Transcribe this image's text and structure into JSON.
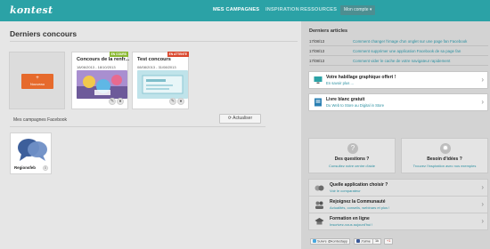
{
  "app": {
    "logo": "kontest"
  },
  "nav": {
    "items": [
      {
        "label": "MES CAMPAGNES"
      },
      {
        "label": "INSPIRATION"
      },
      {
        "label": "RESSOURCES"
      }
    ],
    "account_label": "Mon compte ▾"
  },
  "main": {
    "title": "Derniers concours",
    "new_button": {
      "plus": "+",
      "label": "Nouveau"
    },
    "campaigns": [
      {
        "title": "Concours de la renfr...",
        "dates": "18/06/2013 - 18/10/2013",
        "badge": "EN COURS",
        "thumb_color": "#8e6fb6"
      },
      {
        "title": "Test concours",
        "dates": "08/08/2013 - 31/08/2013",
        "badge": "EN ATTENTE",
        "thumb_color": "#9fd0dc"
      }
    ],
    "facebook_label": "Mes campagnes Facebook",
    "refresh_label": "Actualiser",
    "page": {
      "name": "Regionsfeb",
      "count": "0"
    }
  },
  "sidebar": {
    "articles_title": "Derniers articles",
    "articles": [
      {
        "date": "17/08/13",
        "text": "Comment changer l'image d'un onglet sur une page fan Facebook"
      },
      {
        "date": "17/08/13",
        "text": "Comment supprimer une application Facebook de sa page fan"
      },
      {
        "date": "17/08/13",
        "text": "Comment vider le cache de votre navigateur rapidement"
      }
    ],
    "boxes": [
      {
        "title": "Votre habillage graphique offert !",
        "sub": "En savoir plus ...",
        "icon_color": "#2ba2a6"
      },
      {
        "title": "Livre blanc gratuit",
        "sub": "Du Web to Store au Digital in Store",
        "icon_color": "#e66a2c"
      }
    ],
    "tiles": [
      {
        "icon": "?",
        "title": "Des questions ?",
        "sub": "Consultez notre centre d'aide"
      },
      {
        "icon": "✹",
        "title": "Besoin d'idées ?",
        "sub": "Trouvez l'inspiration avec nos exemples"
      }
    ],
    "rows": [
      {
        "title": "Quelle application choisir ?",
        "sub": "Voir le comparateur"
      },
      {
        "title": "Rejoignez la Communauté",
        "sub": "Actualités, conseils, webinars et plus !"
      },
      {
        "title": "Formation en ligne",
        "sub": "Inscrivez-vous aujourd'hui !"
      }
    ],
    "social": {
      "twitter": "Suivre @kontestapp",
      "facebook": "J'aime",
      "facebook_count": "1k",
      "gplus": "+1"
    }
  },
  "colors": {
    "brand": "#2ba2a6",
    "accent": "#e66a2c",
    "link": "#2a8fa0"
  }
}
